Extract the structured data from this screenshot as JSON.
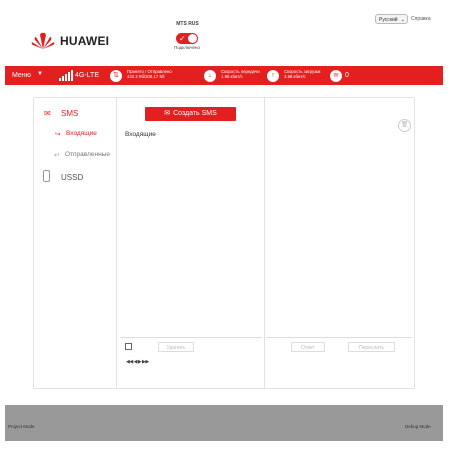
{
  "header": {
    "brand": "HUAWEI",
    "carrier": "MTS RUS",
    "connection_status": "Подключено",
    "language": "Русский",
    "help": "Справка"
  },
  "statusbar": {
    "menu": "Меню",
    "network": "4G-LTE",
    "traffic_label": "Принято / Отправлено",
    "traffic_value": "442.2 Кб/208.17 Кб",
    "download_label": "Скорость передачи",
    "download_value": "1.98 кбит/с",
    "upload_label": "Скорость загрузки",
    "upload_value": "3.68 кбит/с",
    "messages": "0"
  },
  "sidebar": {
    "sms": "SMS",
    "inbox": "Входящие",
    "sent": "Отправленные",
    "ussd": "USSD"
  },
  "main": {
    "create_sms": "Создать SMS",
    "list_title": "Входящие",
    "delete": "Удалить",
    "pager": "◀◀ ◀ ▶ ▶▶",
    "reply": "Ответ",
    "forward": "Переслать"
  },
  "footer": {
    "project_mode": "Project Mode",
    "debug_mode": "Debug Mode"
  },
  "colors": {
    "accent": "#e41f1f"
  }
}
